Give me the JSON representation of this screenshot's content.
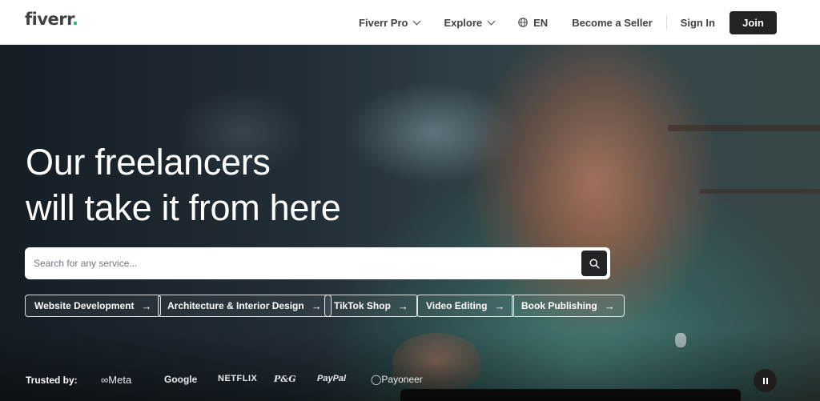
{
  "header": {
    "logo": "fiverr",
    "logo_dot": ".",
    "nav": {
      "fiverr_pro": "Fiverr Pro",
      "explore": "Explore",
      "language": "EN",
      "become_seller": "Become a Seller",
      "sign_in": "Sign In",
      "join": "Join"
    }
  },
  "hero": {
    "headline_line1": "Our freelancers",
    "headline_line2": "will take it from here",
    "search": {
      "placeholder": "Search for any service..."
    },
    "chips": [
      {
        "label": "Website Development",
        "arrow": "→"
      },
      {
        "label": "Architecture & Interior Design",
        "arrow": "→"
      },
      {
        "label": "TikTok Shop",
        "arrow": "→"
      },
      {
        "label": "Video Editing",
        "arrow": "→"
      },
      {
        "label": "Book Publishing",
        "arrow": "→"
      }
    ],
    "trusted_label": "Trusted by:",
    "brands": [
      "∞Meta",
      "Google",
      "NETFLIX",
      "P&G",
      "PayPal",
      "◯Payoneer"
    ]
  },
  "icons": {
    "search": "search-icon",
    "globe": "globe-icon",
    "chevron": "chevron-down-icon",
    "pause": "pause-icon"
  },
  "colors": {
    "brand_green": "#1dbf73",
    "dark": "#222325",
    "text": "#404145"
  }
}
